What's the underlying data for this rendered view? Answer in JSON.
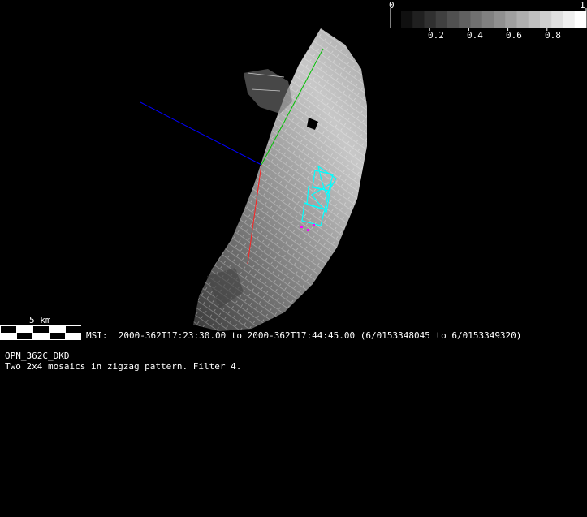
{
  "colorbar": {
    "min_label": "0",
    "max_label": "1",
    "tick_labels": [
      "0.2",
      "0.4",
      "0.6",
      "0.8"
    ],
    "steps": 16
  },
  "scale_bar": {
    "label": "5 km",
    "segments": 5
  },
  "observation": {
    "time_range": "MSI:  2000-362T17:23:30.00 to 2000-362T17:44:45.00 (6/0153348045 to 6/0153349320)",
    "sequence_id": "OPN_362C_DKD",
    "description": "Two 2x4 mosaics in zigzag pattern. Filter 4."
  },
  "colors": {
    "axis_x": "#0000ff",
    "axis_y": "#00c000",
    "axis_z": "#ff2020",
    "footprint": "#00ffff",
    "markers": "#ff00ff"
  }
}
